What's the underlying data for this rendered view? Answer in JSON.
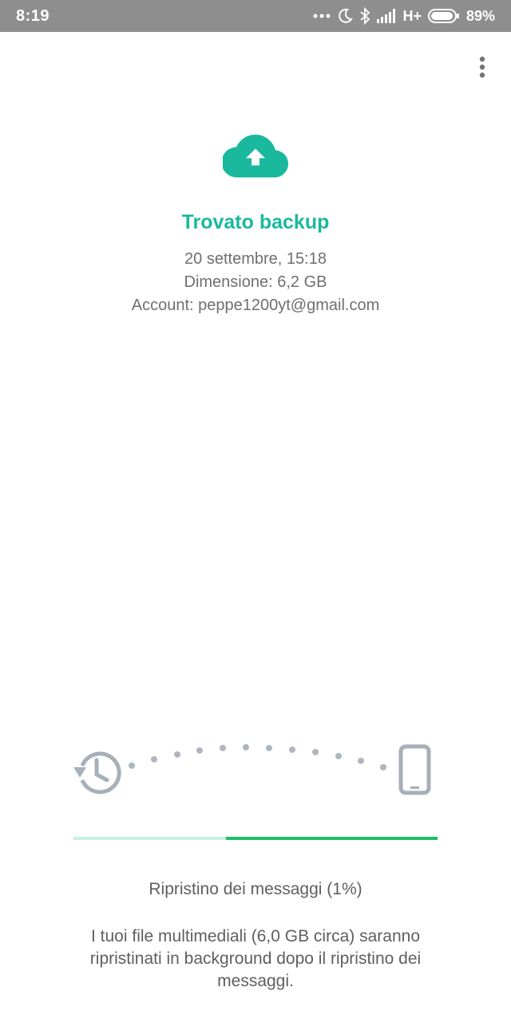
{
  "status_bar": {
    "time": "8:19",
    "network": "H+",
    "battery_percent": "89%",
    "icons": [
      "more-notifications-icon",
      "moon-icon",
      "bluetooth-icon",
      "signal-icon",
      "battery-icon"
    ]
  },
  "menu": {
    "icon": "overflow-menu-icon"
  },
  "backup": {
    "icon": "cloud-upload-icon",
    "title": "Trovato backup",
    "date": "20 settembre, 15:18",
    "size": "Dimensione: 6,2 GB",
    "account": "Account: peppe1200yt@gmail.com"
  },
  "transfer": {
    "source_icon": "history-icon",
    "target_icon": "phone-icon",
    "dots_color": "#b0b6bd"
  },
  "progress": {
    "value_percent": 1,
    "track_color": "#c8efe4",
    "fill_color": "#1ebe66"
  },
  "restore": {
    "status": "Ripristino dei messaggi (1%)",
    "note": "I tuoi file multimediali (6,0 GB circa) saranno ripristinati in background dopo il ripristino dei messaggi."
  },
  "colors": {
    "accent": "#1ab99e",
    "status_bar": "#8e8e8e"
  }
}
